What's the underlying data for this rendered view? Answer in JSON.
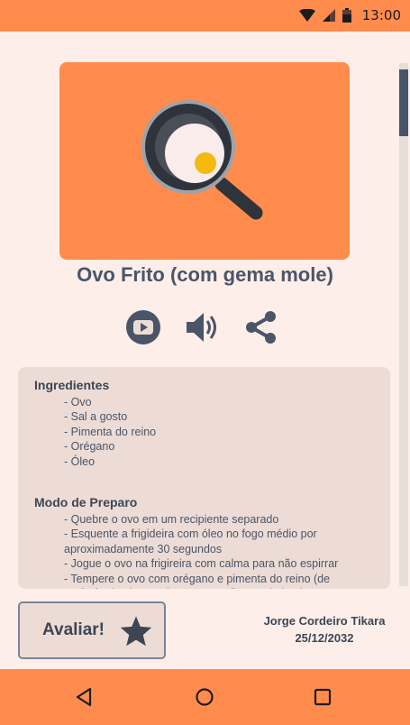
{
  "status_bar": {
    "time": "13:00",
    "icons": [
      "wifi-icon",
      "signal-icon",
      "battery-icon"
    ]
  },
  "recipe": {
    "title": "Ovo Frito (com gema mole)",
    "image_icon": "frying-pan-egg-icon"
  },
  "actions": [
    {
      "icon": "youtube-icon"
    },
    {
      "icon": "speaker-icon"
    },
    {
      "icon": "share-icon"
    }
  ],
  "ingredients": {
    "title": "Ingredientes",
    "items": [
      "- Ovo",
      "- Sal a gosto",
      "- Pimenta do reino",
      "- Orégano",
      "- Óleo"
    ]
  },
  "preparation": {
    "title": "Modo de Preparo",
    "steps": [
      "- Quebre o ovo em um recipiente separado",
      "- Esquente a frigideira com óleo no fogo médio por aproximadamente 30 segundos",
      "- Jogue o ovo na frigireira com calma para não espirrar",
      "- Tempere o ovo com orégano e pimenta do reino (de preferência pimenta branca para ficar mais bonito na"
    ]
  },
  "rate_button": {
    "label": "Avaliar!",
    "icon": "star-icon"
  },
  "author": {
    "name": "Jorge Cordeiro Tikara",
    "date": "25/12/2032"
  },
  "nav_bar": {
    "icons": [
      "back-icon",
      "home-icon",
      "recents-icon"
    ]
  },
  "colors": {
    "accent": "#ff8c4d",
    "background": "#fdeee9",
    "card": "#ecdcd5",
    "text": "#4a5568"
  }
}
